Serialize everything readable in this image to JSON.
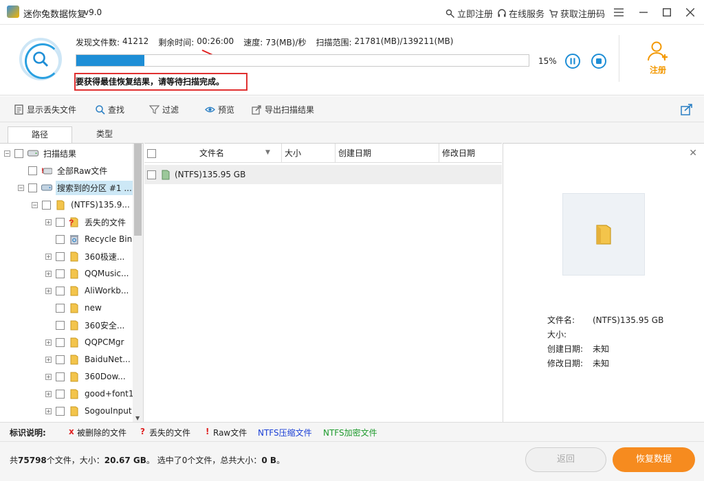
{
  "app": {
    "title": "迷你兔数据恢复",
    "version": "v9.0"
  },
  "titlebar": {
    "register_now": "立即注册",
    "online_service": "在线服务",
    "get_code": "获取注册码"
  },
  "scan": {
    "found_label": "发现文件数:",
    "found_value": "41212",
    "remaining_label": "剩余时间:",
    "remaining_value": "00:26:00",
    "speed_label": "速度:",
    "speed_value": "73(MB)/秒",
    "range_label": "扫描范围:",
    "range_value": "21781(MB)/139211(MB)",
    "progress_percent": 15,
    "progress_text": "15%",
    "notice": "要获得最佳恢复结果，请等待扫描完成。",
    "register_label": "注册"
  },
  "toolbar": {
    "show_lost": "显示丢失文件",
    "find": "查找",
    "filter": "过滤",
    "preview": "预览",
    "export": "导出扫描结果"
  },
  "tabs": [
    "路径",
    "类型"
  ],
  "tree": [
    {
      "label": "扫描结果",
      "icon": "drive-icon"
    },
    {
      "label": "全部Raw文件",
      "icon": "raw-drive-icon"
    },
    {
      "label": "搜索到的分区 #1 ...",
      "icon": "partition-icon"
    },
    {
      "label": "(NTFS)135.9...",
      "icon": "folder-icon"
    },
    {
      "label": "丢失的文件",
      "icon": "lost-folder-icon"
    },
    {
      "label": "Recycle Bin",
      "icon": "recycle-bin-icon"
    },
    {
      "label": "360极速...",
      "icon": "folder-icon"
    },
    {
      "label": "QQMusic...",
      "icon": "folder-icon"
    },
    {
      "label": "AliWorkb...",
      "icon": "folder-icon"
    },
    {
      "label": "new",
      "icon": "folder-icon"
    },
    {
      "label": "360安全...",
      "icon": "folder-icon"
    },
    {
      "label": "QQPCMgr",
      "icon": "folder-icon"
    },
    {
      "label": "BaiduNet...",
      "icon": "folder-icon"
    },
    {
      "label": "360Dow...",
      "icon": "folder-icon"
    },
    {
      "label": "good+font1",
      "icon": "folder-icon"
    },
    {
      "label": "SogouInput",
      "icon": "folder-icon"
    }
  ],
  "file_list": {
    "columns": [
      "文件名",
      "大小",
      "创建日期",
      "修改日期"
    ],
    "rows": [
      {
        "name": "(NTFS)135.95 GB"
      }
    ]
  },
  "preview": {
    "filename_label": "文件名:",
    "filename_value": "(NTFS)135.95 GB",
    "size_label": "大小:",
    "size_value": "",
    "created_label": "创建日期:",
    "created_value": "未知",
    "modified_label": "修改日期:",
    "modified_value": "未知"
  },
  "legend": {
    "title": "标识说明:",
    "deleted_mark": "x",
    "deleted": "被删除的文件",
    "lost_mark": "?",
    "lost": "丢失的文件",
    "raw_mark": "!",
    "raw": "Raw文件",
    "compressed": "NTFS压缩文件",
    "encrypted": "NTFS加密文件"
  },
  "footer": {
    "summary_prefix": "共",
    "total_files": "75798",
    "summary_files_suffix": "个文件，大小：",
    "total_size": "20.67 GB",
    "summary_mid": "。 选中了0个文件，总共大小：",
    "selected_size": "0 B",
    "summary_end": "。",
    "back": "返回",
    "recover": "恢复数据"
  },
  "colors": {
    "accent": "#1e8ed6",
    "orange": "#f68b1f",
    "notice_border": "#e03030",
    "compressed": "#1a3fd6",
    "encrypted": "#1d9a2c"
  }
}
